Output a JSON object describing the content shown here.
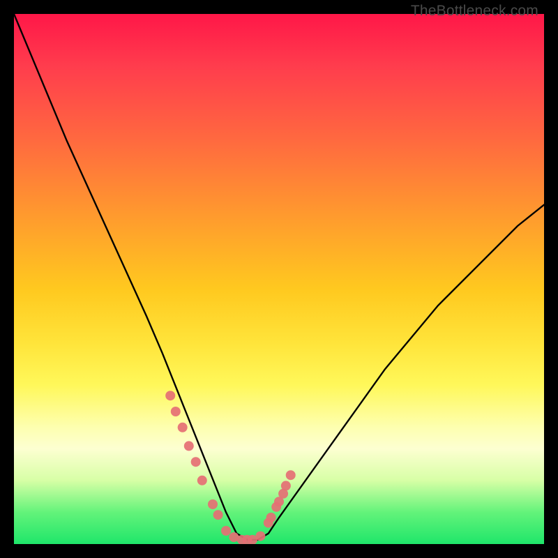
{
  "watermark": "TheBottleneck.com",
  "chart_data": {
    "type": "line",
    "title": "",
    "xlabel": "",
    "ylabel": "",
    "x_range": [
      0,
      100
    ],
    "y_range": [
      0,
      100
    ],
    "curve": {
      "name": "bottleneck-curve",
      "color": "#000000",
      "x": [
        0,
        5,
        10,
        15,
        20,
        25,
        28,
        30,
        32,
        34,
        36,
        38,
        40,
        42,
        44,
        46,
        48,
        50,
        55,
        60,
        65,
        70,
        75,
        80,
        85,
        90,
        95,
        100
      ],
      "y": [
        100,
        88,
        76,
        65,
        54,
        43,
        36,
        31,
        26,
        21,
        16,
        11,
        6,
        2,
        0.8,
        0.8,
        2,
        5,
        12,
        19,
        26,
        33,
        39,
        45,
        50,
        55,
        60,
        64
      ]
    },
    "scatter": {
      "name": "sample-gpus",
      "color": "#e56f74",
      "radius_px": 7,
      "x": [
        29.5,
        30.5,
        31.8,
        33.0,
        34.3,
        35.5,
        37.5,
        38.5,
        40.0,
        41.5,
        43.0,
        44.0,
        45.0,
        46.5,
        48.0,
        48.5,
        49.5,
        50.0,
        50.8,
        51.3,
        52.2
      ],
      "y": [
        28.0,
        25.0,
        22.0,
        18.5,
        15.5,
        12.0,
        7.5,
        5.5,
        2.5,
        1.3,
        0.8,
        0.8,
        0.8,
        1.5,
        4.0,
        5.0,
        7.0,
        8.0,
        9.5,
        11.0,
        13.0
      ]
    }
  }
}
